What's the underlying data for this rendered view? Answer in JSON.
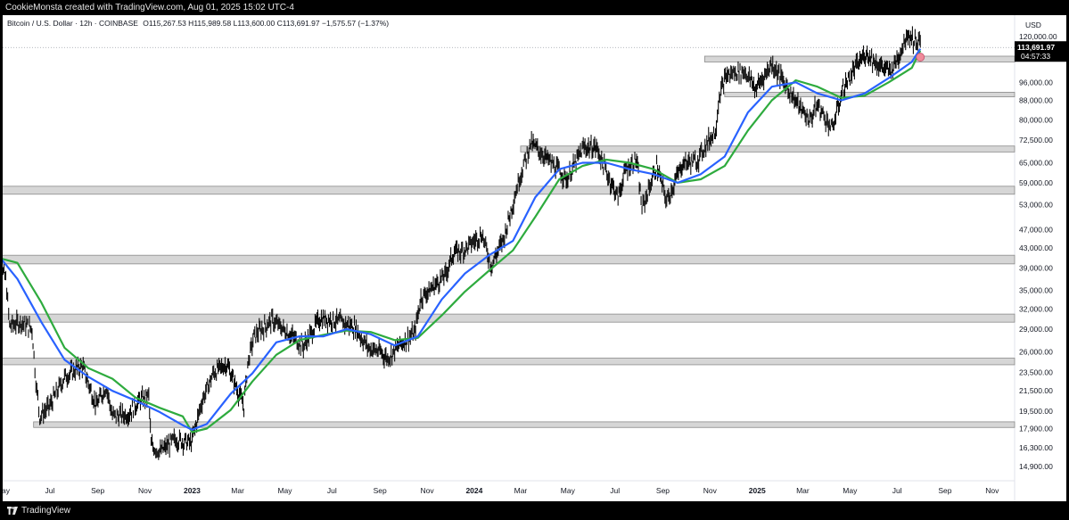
{
  "header": {
    "caption": "CookieMonsta created with TradingView.com, Aug 01, 2025 15:02 UTC-4"
  },
  "legend": {
    "symbol": "Bitcoin / U.S. Dollar · 12h · COINBASE",
    "ohlc": "O115,267.53  H115,989.58  L113,600.00  C113,691.97  −1,575.57 (−1.37%)"
  },
  "price_axis": {
    "currency": "USD",
    "last_price": "113,691.97",
    "countdown": "04:57:33"
  },
  "footer": {
    "brand": "TradingView"
  },
  "colors": {
    "candles": "#0b0b0b",
    "ma_blue": "#2962ff",
    "ma_green": "#2eab3e",
    "zones": "#d6d6d6",
    "zone_border": "#8a8a8a",
    "marker": "#f08a9a"
  },
  "chart_data": {
    "type": "line",
    "title": "Bitcoin / U.S. Dollar · 12h · COINBASE",
    "ylabel": "USD",
    "yscale": "log",
    "ylim": [
      13900,
      133000
    ],
    "xlim": [
      "2022-05-01",
      "2025-11-30"
    ],
    "y_ticks": [
      "120,000.00",
      "96,000.00",
      "88,000.00",
      "80,000.00",
      "72,500.00",
      "65,000.00",
      "59,000.00",
      "53,000.00",
      "47,000.00",
      "43,000.00",
      "39,000.00",
      "35,000.00",
      "32,000.00",
      "29,000.00",
      "26,000.00",
      "23,500.00",
      "21,500.00",
      "19,500.00",
      "17,900.00",
      "16,300.00",
      "14,900.00"
    ],
    "x_ticks": [
      {
        "date": "2022-05-01",
        "label": "May",
        "year": false
      },
      {
        "date": "2022-07-01",
        "label": "Jul",
        "year": false
      },
      {
        "date": "2022-09-01",
        "label": "Sep",
        "year": false
      },
      {
        "date": "2022-11-01",
        "label": "Nov",
        "year": false
      },
      {
        "date": "2023-01-01",
        "label": "2023",
        "year": true
      },
      {
        "date": "2023-03-01",
        "label": "Mar",
        "year": false
      },
      {
        "date": "2023-05-01",
        "label": "May",
        "year": false
      },
      {
        "date": "2023-07-01",
        "label": "Jul",
        "year": false
      },
      {
        "date": "2023-09-01",
        "label": "Sep",
        "year": false
      },
      {
        "date": "2023-11-01",
        "label": "Nov",
        "year": false
      },
      {
        "date": "2024-01-01",
        "label": "2024",
        "year": true
      },
      {
        "date": "2024-03-01",
        "label": "Mar",
        "year": false
      },
      {
        "date": "2024-05-01",
        "label": "May",
        "year": false
      },
      {
        "date": "2024-07-01",
        "label": "Jul",
        "year": false
      },
      {
        "date": "2024-09-01",
        "label": "Sep",
        "year": false
      },
      {
        "date": "2024-11-01",
        "label": "Nov",
        "year": false
      },
      {
        "date": "2025-01-01",
        "label": "2025",
        "year": true
      },
      {
        "date": "2025-03-01",
        "label": "Mar",
        "year": false
      },
      {
        "date": "2025-05-01",
        "label": "May",
        "year": false
      },
      {
        "date": "2025-07-01",
        "label": "Jul",
        "year": false
      },
      {
        "date": "2025-09-01",
        "label": "Sep",
        "year": false
      },
      {
        "date": "2025-11-01",
        "label": "Nov",
        "year": false
      }
    ],
    "price_series": {
      "x": [
        "2022-04-20",
        "2022-05-05",
        "2022-05-10",
        "2022-05-25",
        "2022-06-08",
        "2022-06-13",
        "2022-06-18",
        "2022-07-01",
        "2022-07-20",
        "2022-08-12",
        "2022-08-30",
        "2022-09-12",
        "2022-09-20",
        "2022-10-10",
        "2022-10-25",
        "2022-11-06",
        "2022-11-09",
        "2022-11-21",
        "2022-12-10",
        "2022-12-31",
        "2023-01-14",
        "2023-01-29",
        "2023-02-15",
        "2023-03-09",
        "2023-03-14",
        "2023-03-22",
        "2023-04-14",
        "2023-05-05",
        "2023-05-25",
        "2023-06-15",
        "2023-06-23",
        "2023-07-13",
        "2023-07-30",
        "2023-08-17",
        "2023-09-01",
        "2023-09-11",
        "2023-09-28",
        "2023-10-16",
        "2023-10-24",
        "2023-11-08",
        "2023-11-25",
        "2023-12-05",
        "2023-12-18",
        "2024-01-11",
        "2024-01-23",
        "2024-02-08",
        "2024-02-28",
        "2024-03-14",
        "2024-03-25",
        "2024-04-13",
        "2024-04-30",
        "2024-05-21",
        "2024-06-07",
        "2024-06-24",
        "2024-07-05",
        "2024-07-15",
        "2024-07-29",
        "2024-08-05",
        "2024-08-24",
        "2024-09-06",
        "2024-09-27",
        "2024-10-15",
        "2024-10-29",
        "2024-11-08",
        "2024-11-13",
        "2024-11-22",
        "2024-12-05",
        "2024-12-17",
        "2024-12-30",
        "2025-01-20",
        "2025-02-03",
        "2025-02-25",
        "2025-03-10",
        "2025-03-20",
        "2025-04-08",
        "2025-04-22",
        "2025-05-08",
        "2025-05-22",
        "2025-06-05",
        "2025-06-22",
        "2025-07-03",
        "2025-07-11",
        "2025-07-14",
        "2025-07-22",
        "2025-07-31",
        "2025-08-01"
      ],
      "y": [
        41500,
        37000,
        29500,
        30000,
        29000,
        22500,
        19000,
        20000,
        23000,
        24300,
        20000,
        22000,
        19000,
        19200,
        20500,
        21000,
        16500,
        16000,
        17000,
        16700,
        20500,
        23500,
        24500,
        20000,
        24500,
        28000,
        30300,
        28500,
        26700,
        30500,
        30500,
        30000,
        29300,
        26500,
        26000,
        25200,
        27000,
        28500,
        33800,
        35500,
        37800,
        42000,
        42500,
        46000,
        39500,
        45000,
        60000,
        71500,
        69000,
        64000,
        60000,
        70000,
        70000,
        60000,
        55000,
        63000,
        66000,
        52000,
        64000,
        54000,
        65000,
        65500,
        72000,
        76000,
        90000,
        99000,
        101000,
        101000,
        93000,
        105000,
        97000,
        85000,
        80000,
        86000,
        76500,
        93000,
        103000,
        111000,
        105000,
        101000,
        109000,
        118000,
        122000,
        118000,
        116000,
        113700
      ]
    },
    "ma_blue": {
      "x": [
        "2022-04-20",
        "2022-05-20",
        "2022-06-20",
        "2022-07-20",
        "2022-08-20",
        "2022-09-20",
        "2022-10-20",
        "2022-11-20",
        "2022-12-20",
        "2023-01-01",
        "2023-01-20",
        "2023-02-20",
        "2023-03-20",
        "2023-04-20",
        "2023-05-20",
        "2023-06-20",
        "2023-07-20",
        "2023-08-20",
        "2023-09-20",
        "2023-10-20",
        "2023-11-20",
        "2023-12-20",
        "2024-01-20",
        "2024-02-20",
        "2024-03-20",
        "2024-04-20",
        "2024-05-20",
        "2024-06-20",
        "2024-07-20",
        "2024-08-20",
        "2024-09-20",
        "2024-10-20",
        "2024-11-20",
        "2024-12-20",
        "2025-01-20",
        "2025-02-20",
        "2025-03-20",
        "2025-04-20",
        "2025-05-20",
        "2025-06-20",
        "2025-07-20",
        "2025-07-31"
      ],
      "y": [
        42500,
        37000,
        30000,
        25000,
        23000,
        21500,
        20500,
        19400,
        18200,
        17800,
        18300,
        21200,
        23400,
        27200,
        28000,
        28000,
        29000,
        28300,
        26800,
        28000,
        33500,
        38000,
        41500,
        44500,
        55000,
        63000,
        65000,
        65000,
        63000,
        61500,
        59000,
        61500,
        67000,
        83000,
        94000,
        96000,
        91000,
        88000,
        91000,
        98000,
        106000,
        113000
      ]
    },
    "ma_green": {
      "x": [
        "2022-04-20",
        "2022-05-20",
        "2022-06-20",
        "2022-07-20",
        "2022-08-20",
        "2022-09-20",
        "2022-10-20",
        "2022-11-20",
        "2022-12-20",
        "2023-01-01",
        "2023-01-20",
        "2023-02-20",
        "2023-03-20",
        "2023-04-20",
        "2023-05-20",
        "2023-06-20",
        "2023-07-20",
        "2023-08-20",
        "2023-09-20",
        "2023-10-20",
        "2023-11-20",
        "2023-12-20",
        "2024-01-20",
        "2024-02-20",
        "2024-03-20",
        "2024-04-20",
        "2024-05-20",
        "2024-06-20",
        "2024-07-20",
        "2024-08-20",
        "2024-09-20",
        "2024-10-20",
        "2024-11-20",
        "2024-12-20",
        "2025-01-20",
        "2025-02-20",
        "2025-03-20",
        "2025-04-20",
        "2025-05-20",
        "2025-06-20",
        "2025-07-20",
        "2025-07-31"
      ],
      "y": [
        41200,
        40000,
        33000,
        26500,
        24000,
        22800,
        20800,
        19800,
        19000,
        17600,
        17900,
        19600,
        22500,
        25600,
        27500,
        28200,
        28800,
        28600,
        27500,
        27800,
        31000,
        34800,
        38500,
        42500,
        50000,
        60000,
        64000,
        66000,
        65000,
        63000,
        59000,
        60000,
        64000,
        76000,
        88000,
        97000,
        94000,
        89000,
        90000,
        96000,
        103000,
        112000
      ]
    },
    "zones": [
      {
        "date_from": "2024-10-25",
        "date_to": "2025-11-30",
        "low": 106000,
        "high": 109000
      },
      {
        "date_from": "2024-11-20",
        "date_to": "2025-11-30",
        "low": 89500,
        "high": 91500
      },
      {
        "date_from": "2024-03-01",
        "date_to": "2025-11-30",
        "low": 68500,
        "high": 70500
      },
      {
        "date_from": "2022-04-10",
        "date_to": "2025-11-30",
        "low": 55800,
        "high": 58000
      },
      {
        "date_from": "2022-04-10",
        "date_to": "2025-11-30",
        "low": 39800,
        "high": 41500
      },
      {
        "date_from": "2022-04-10",
        "date_to": "2025-11-30",
        "low": 30000,
        "high": 31200
      },
      {
        "date_from": "2022-04-25",
        "date_to": "2025-11-30",
        "low": 24400,
        "high": 25200
      },
      {
        "date_from": "2022-06-10",
        "date_to": "2025-11-30",
        "low": 18000,
        "high": 18500
      }
    ],
    "marker": {
      "date": "2025-07-31",
      "value": 108500
    }
  }
}
